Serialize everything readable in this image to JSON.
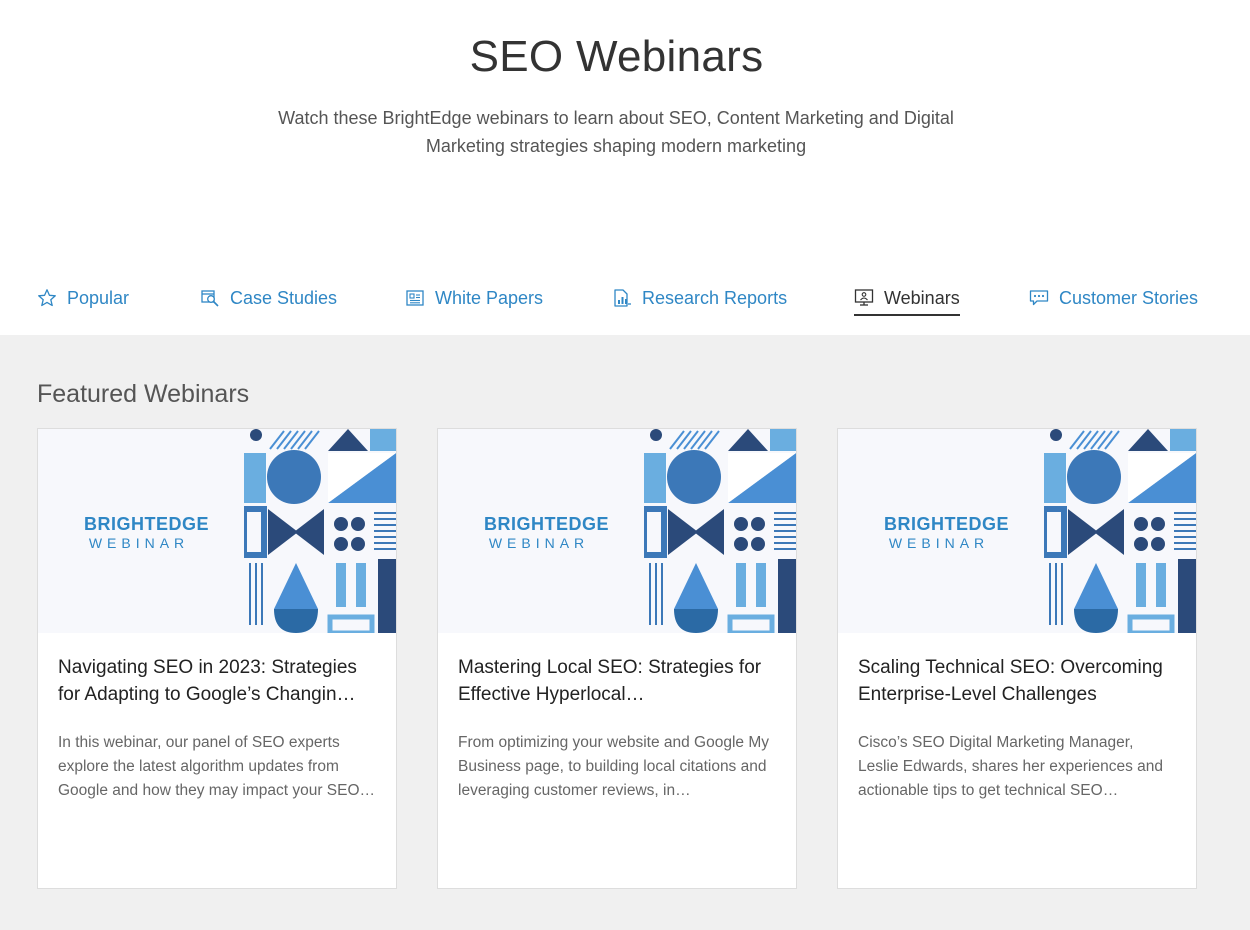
{
  "header": {
    "title": "SEO Webinars",
    "subtitle": "Watch these BrightEdge webinars to learn about SEO, Content Marketing and Digital Marketing strategies shaping modern marketing"
  },
  "tabs": [
    {
      "label": "Popular",
      "icon": "star-icon",
      "active": false
    },
    {
      "label": "Case Studies",
      "icon": "case-study-icon",
      "active": false
    },
    {
      "label": "White Papers",
      "icon": "document-icon",
      "active": false
    },
    {
      "label": "Research Reports",
      "icon": "report-chart-icon",
      "active": false
    },
    {
      "label": "Webinars",
      "icon": "presentation-icon",
      "active": true
    },
    {
      "label": "Customer Stories",
      "icon": "chat-bubble-icon",
      "active": false
    }
  ],
  "featured": {
    "section_title": "Featured Webinars",
    "cards": [
      {
        "logo_top": "BRIGHTEDGE",
        "logo_bottom": "WEBINAR",
        "title": "Navigating SEO in 2023: Strategies for Adapting to Google’s Changin…",
        "description": "In this webinar, our panel of SEO experts explore the latest algorithm updates from Google and how they may impact your SEO…"
      },
      {
        "logo_top": "BRIGHTEDGE",
        "logo_bottom": "WEBINAR",
        "title": "Mastering Local SEO: Strategies for Effective Hyperlocal…",
        "description": "From optimizing your website and Google My Business page, to building local citations and leveraging customer reviews, in…"
      },
      {
        "logo_top": "BRIGHTEDGE",
        "logo_bottom": "WEBINAR",
        "title": "Scaling Technical SEO: Overcoming Enterprise-Level Challenges",
        "description": "Cisco’s SEO Digital Marketing Manager, Leslie Edwards, shares her experiences and actionable tips to get technical SEO…"
      }
    ]
  },
  "colors": {
    "accent": "#2f87c5",
    "dark_blue": "#2b4a7a",
    "mid_blue": "#3c78b8",
    "light_blue": "#6aaee0",
    "section_bg": "#f0f0f0"
  }
}
